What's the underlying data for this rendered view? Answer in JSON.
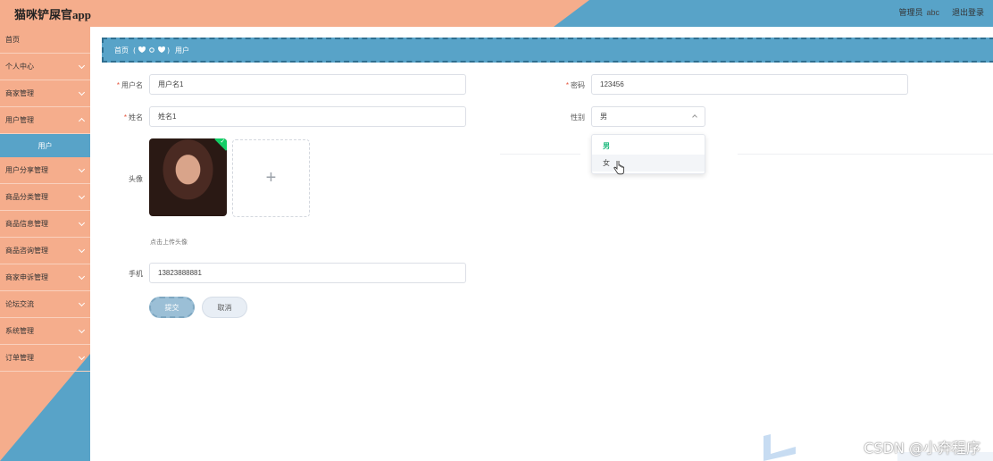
{
  "header": {
    "app_title": "猫咪铲屎官app",
    "role": "管理员",
    "username": "abc",
    "logout": "退出登录"
  },
  "sidebar": {
    "items": [
      {
        "label": "首页",
        "has_arrow": false
      },
      {
        "label": "个人中心",
        "has_arrow": true
      },
      {
        "label": "商家管理",
        "has_arrow": true
      },
      {
        "label": "用户管理",
        "has_arrow": true
      },
      {
        "label": "用户",
        "sub": true
      },
      {
        "label": "用户分享管理",
        "has_arrow": true
      },
      {
        "label": "商品分类管理",
        "has_arrow": true
      },
      {
        "label": "商品信息管理",
        "has_arrow": true
      },
      {
        "label": "商品咨询管理",
        "has_arrow": true
      },
      {
        "label": "商家申诉管理",
        "has_arrow": true
      },
      {
        "label": "论坛交流",
        "has_arrow": true
      },
      {
        "label": "系统管理",
        "has_arrow": true
      },
      {
        "label": "订单管理",
        "has_arrow": true
      }
    ]
  },
  "breadcrumb": {
    "home": "首页",
    "current": "用户"
  },
  "form": {
    "username": {
      "label": "用户名",
      "value": "用户名1",
      "required": true
    },
    "password": {
      "label": "密码",
      "value": "123456",
      "required": true
    },
    "name": {
      "label": "姓名",
      "value": "姓名1",
      "required": true
    },
    "gender": {
      "label": "性别",
      "value": "男"
    },
    "avatar": {
      "label": "头像",
      "hint": "点击上传头像",
      "plus": "+"
    },
    "phone": {
      "label": "手机",
      "value": "13823888881"
    },
    "submit": "提交",
    "cancel": "取消"
  },
  "gender_dropdown": {
    "options": [
      "男",
      "女"
    ],
    "selected": "男",
    "hovered": "女"
  },
  "watermark": "CSDN @小奔程序",
  "colors": {
    "salmon": "#f5ad8c",
    "blue": "#58a3c8",
    "required": "#e5533b",
    "selected_option": "#16b779"
  }
}
